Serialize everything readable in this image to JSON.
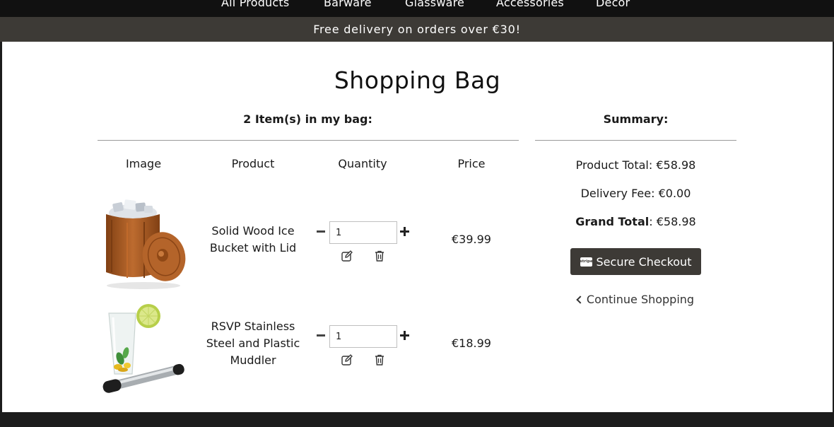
{
  "nav": {
    "items": [
      "All Products",
      "Barware",
      "Glassware",
      "Accessories",
      "Decor"
    ]
  },
  "banner": {
    "text": "Free delivery on orders over €30!"
  },
  "page": {
    "title": "Shopping Bag"
  },
  "bag": {
    "heading": "2 Item(s) in my bag:",
    "columns": [
      "Image",
      "Product",
      "Quantity",
      "Price"
    ],
    "items": [
      {
        "name": "Solid Wood Ice Bucket with Lid",
        "quantity": "1",
        "price": "€39.99",
        "image_icon": "ice-bucket-image"
      },
      {
        "name": "RSVP Stainless Steel and Plastic Muddler",
        "quantity": "1",
        "price": "€18.99",
        "image_icon": "muddler-image"
      }
    ]
  },
  "summary": {
    "heading": "Summary:",
    "product_total": "Product Total: €58.98",
    "delivery_fee": "Delivery Fee: €0.00",
    "grand_total_label": "Grand Total",
    "grand_total_value": ": €58.98",
    "checkout_label": "Secure Checkout",
    "stripe_badge": "stripe",
    "continue_label": "Continue Shopping"
  },
  "colors": {
    "nav_bg": "#111111",
    "banner_bg": "#3d3a36",
    "button_bg": "#3d3a36"
  }
}
